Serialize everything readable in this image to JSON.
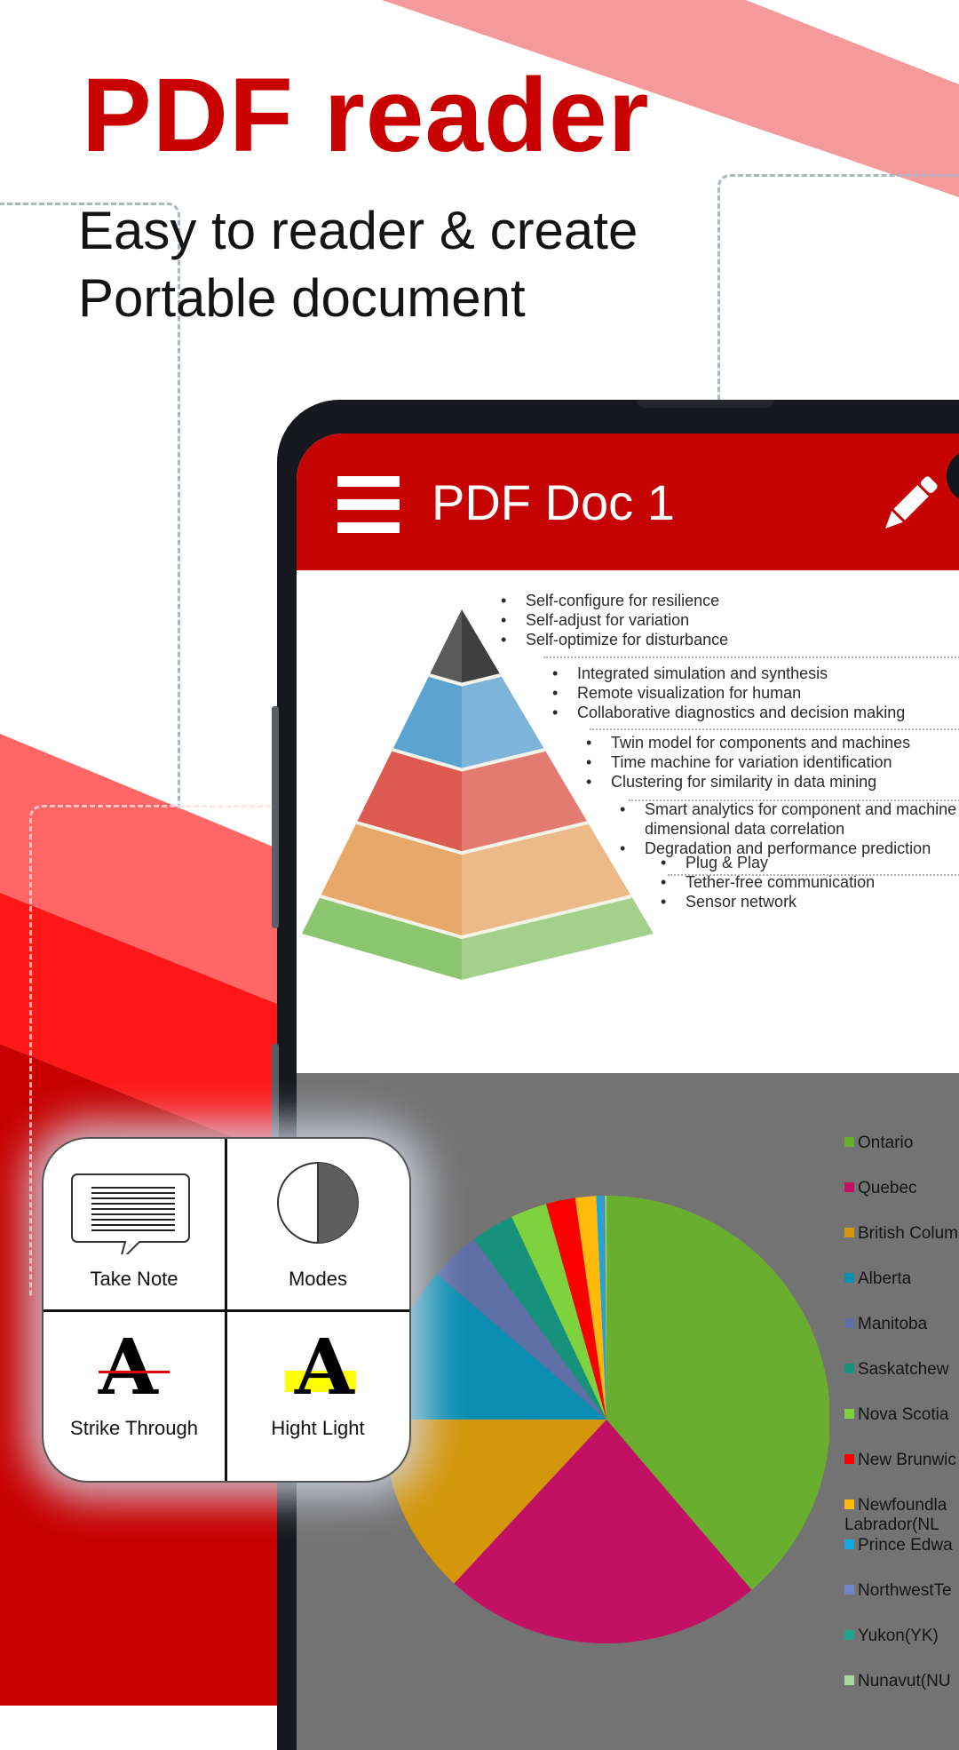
{
  "promo": {
    "title": "PDF reader",
    "subtitle": "Easy to reader & create\nPortable document",
    "colors": {
      "brand_red": "#c80000",
      "light_red": "#f59a9a",
      "mid_red": "#ff6666",
      "bright_red": "#fe1818"
    }
  },
  "app": {
    "doc_title": "PDF Doc 1",
    "menu_icon": "hamburger-menu-icon",
    "edit_icon": "pencil-icon",
    "app_bar_color": "#c70404"
  },
  "page1": {
    "pyramid_levels": [
      {
        "color": "#5a5a5a",
        "bullets": [
          "Self-configure for resilience",
          "Self-adjust for variation",
          "Self-optimize for disturbance"
        ]
      },
      {
        "color": "#5ba3d0",
        "bullets": [
          "Integrated simulation and synthesis",
          "Remote visualization for human",
          "Collaborative diagnostics and decision making"
        ]
      },
      {
        "color": "#dc5a4f",
        "bullets": [
          "Twin model for components and machines",
          "Time machine for variation identification",
          "Clustering for similarity in data mining"
        ]
      },
      {
        "color": "#e7a86a",
        "bullets": [
          "Smart analytics for component and machine health, multi-",
          "dimensional data correlation",
          "Degradation and performance prediction"
        ]
      },
      {
        "color": "#8cc56f",
        "bullets": [
          "Plug & Play",
          "Tether-free communication",
          "Sensor network"
        ]
      }
    ]
  },
  "chart_data": {
    "type": "pie",
    "title": "",
    "legend_position": "right",
    "start_angle": "12 o'clock, clockwise",
    "categories": [
      "Ontario",
      "Quebec",
      "British Columbia",
      "Alberta",
      "Manitoba",
      "Saskatchewan",
      "Nova Scotia",
      "New Brunswick",
      "Newfoundland and Labrador(NL)",
      "Prince Edward Island",
      "Northwest Territories",
      "Yukon(YK)",
      "Nunavut(NU)"
    ],
    "legend_labels": [
      "Ontario",
      "Quebec",
      "British Colum",
      "Alberta",
      "Manitoba",
      "Saskatchew",
      "Nova Scotia",
      "New Brunwic",
      "Newfoundla\nLabrador(NL",
      "Prince Edwa",
      "NorthwestTe",
      "Yukon(YK)",
      "Nunavut(NU"
    ],
    "values": [
      38.5,
      23.0,
      13.0,
      11.2,
      3.6,
      3.1,
      2.6,
      2.1,
      1.5,
      0.4,
      0.12,
      0.1,
      0.1
    ],
    "unit": "% (estimated share)",
    "colors": [
      "#6aae30",
      "#c21062",
      "#d4970a",
      "#0a8fb3",
      "#5e6fa6",
      "#16917c",
      "#7ed23d",
      "#fb0000",
      "#ffb90b",
      "#17a8e0",
      "#6f86c6",
      "#1fa58e",
      "#a8d99a"
    ]
  },
  "tools": [
    {
      "label": "Take Note",
      "icon": "note-bubble-icon"
    },
    {
      "label": "Modes",
      "icon": "half-circle-contrast-icon"
    },
    {
      "label": "Strike Through",
      "icon": "strikethrough-a-icon",
      "accent": "#e00000",
      "glyph": "A"
    },
    {
      "label": "Hight Light",
      "icon": "highlight-a-icon",
      "accent": "#ffff00",
      "glyph": "A"
    }
  ]
}
